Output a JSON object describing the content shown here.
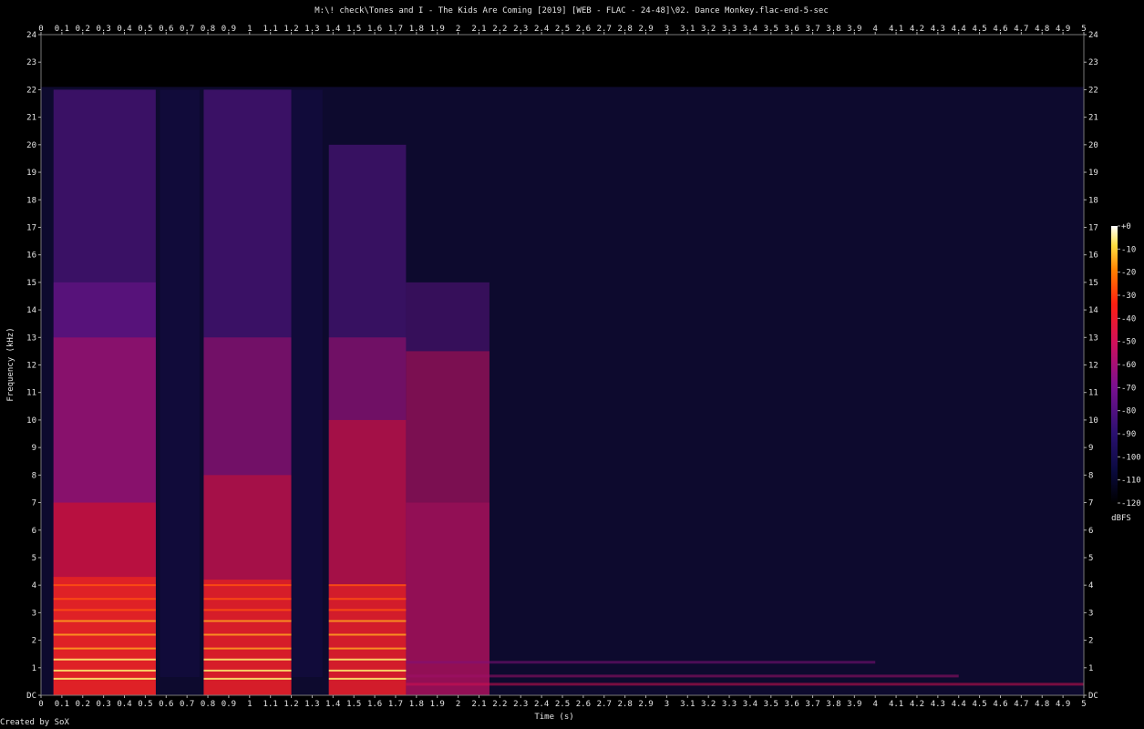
{
  "chart_data": {
    "type": "heatmap",
    "title": "M:\\! check\\Tones and I - The Kids Are Coming [2019] [WEB - FLAC - 24-48]\\02. Dance Monkey.flac-end-5-sec",
    "xlabel": "Time (s)",
    "ylabel": "Frequency (kHz)",
    "xlim": [
      0,
      5
    ],
    "ylim": [
      0,
      24
    ],
    "x_ticks": [
      "0",
      "0.1",
      "0.2",
      "0.3",
      "0.4",
      "0.5",
      "0.6",
      "0.7",
      "0.8",
      "0.9",
      "1",
      "1.1",
      "1.2",
      "1.3",
      "1.4",
      "1.5",
      "1.6",
      "1.7",
      "1.8",
      "1.9",
      "2",
      "2.1",
      "2.2",
      "2.3",
      "2.4",
      "2.5",
      "2.6",
      "2.7",
      "2.8",
      "2.9",
      "3",
      "3.1",
      "3.2",
      "3.3",
      "3.4",
      "3.5",
      "3.6",
      "3.7",
      "3.8",
      "3.9",
      "4",
      "4.1",
      "4.2",
      "4.3",
      "4.4",
      "4.5",
      "4.6",
      "4.7",
      "4.8",
      "4.9",
      "5"
    ],
    "y_ticks": [
      "DC",
      "1",
      "2",
      "3",
      "4",
      "5",
      "6",
      "7",
      "8",
      "9",
      "10",
      "11",
      "12",
      "13",
      "14",
      "15",
      "16",
      "17",
      "18",
      "19",
      "20",
      "21",
      "22",
      "23",
      "24"
    ],
    "colorbar": {
      "label": "dBFS",
      "range": [
        -120,
        0
      ],
      "ticks": [
        "+0",
        "-10",
        "-20",
        "-30",
        "-40",
        "-50",
        "-60",
        "-70",
        "-80",
        "-90",
        "-100",
        "-110",
        "-120"
      ]
    },
    "grid": false,
    "legend": "right"
  },
  "footer": {
    "credit": "Created by SoX"
  }
}
